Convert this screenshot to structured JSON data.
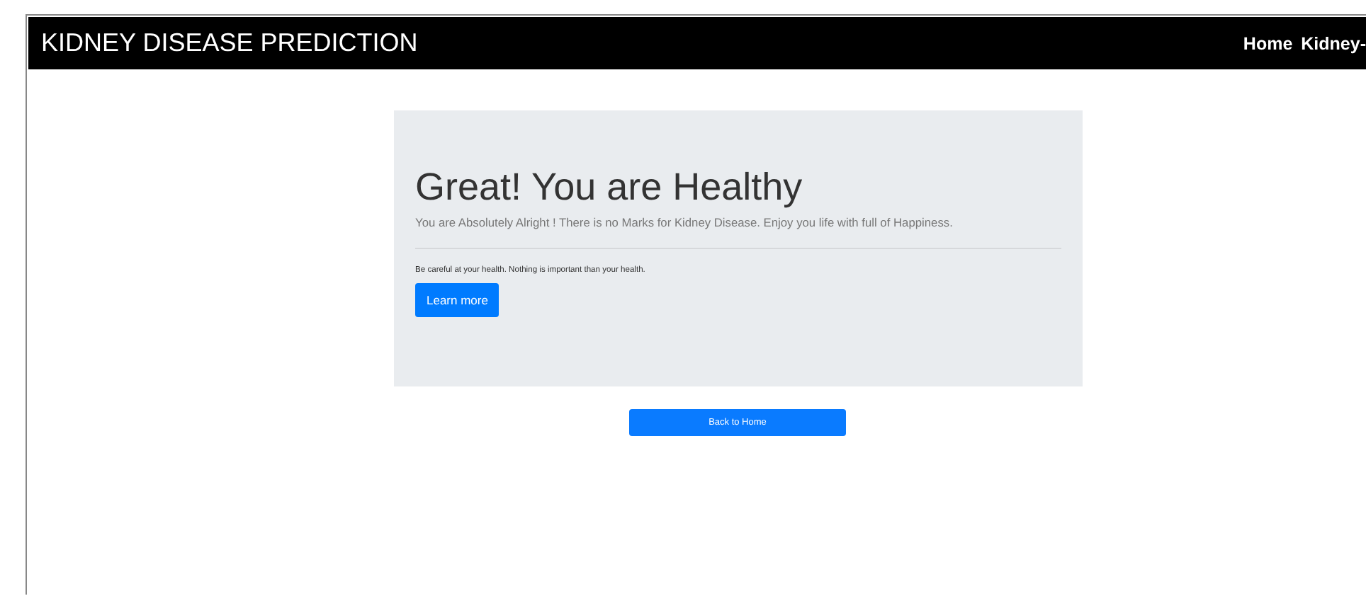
{
  "navbar": {
    "brand": "KIDNEY DISEASE PREDICTION",
    "links": [
      "Home",
      "Kidney-"
    ]
  },
  "result": {
    "heading": "Great! You are Healthy",
    "lead": "You are Absolutely Alright ! There is no Marks for Kidney Disease. Enjoy you life with full of Happiness.",
    "note": "Be careful at your health. Nothing is important than your health.",
    "button": "Learn more"
  },
  "back_button": "Back to Home"
}
